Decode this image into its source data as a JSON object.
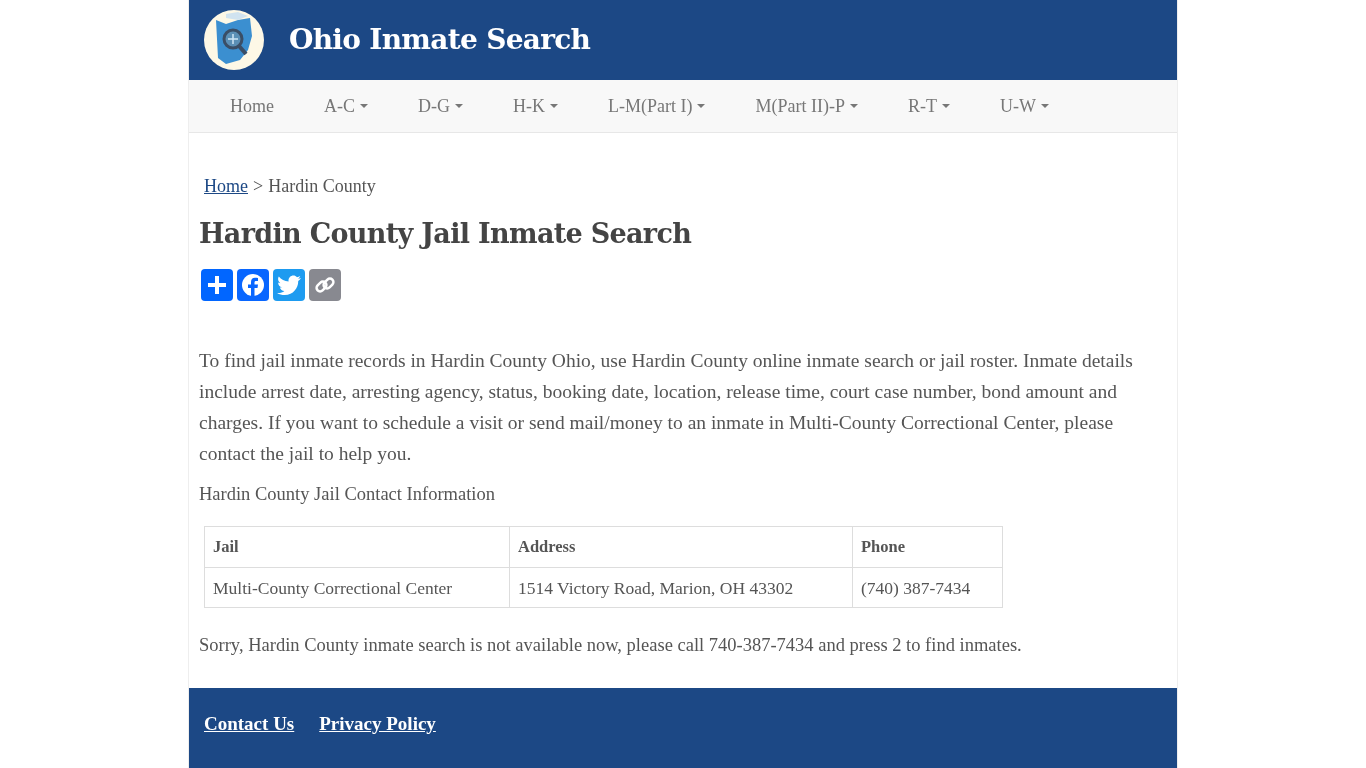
{
  "site": {
    "title": "Ohio Inmate Search"
  },
  "nav": [
    {
      "label": "Home",
      "dropdown": false
    },
    {
      "label": "A-C",
      "dropdown": true
    },
    {
      "label": "D-G",
      "dropdown": true
    },
    {
      "label": "H-K",
      "dropdown": true
    },
    {
      "label": "L-M(Part I)",
      "dropdown": true
    },
    {
      "label": "M(Part II)-P",
      "dropdown": true
    },
    {
      "label": "R-T",
      "dropdown": true
    },
    {
      "label": "U-W",
      "dropdown": true
    }
  ],
  "breadcrumb": {
    "link": "Home",
    "separator": ">",
    "current": "Hardin County"
  },
  "heading": "Hardin County Jail Inmate Search",
  "share_buttons": [
    {
      "kind": "share",
      "color": "#0166ff"
    },
    {
      "kind": "facebook",
      "color": "#0866ff"
    },
    {
      "kind": "twitter",
      "color": "#1d9bf0"
    },
    {
      "kind": "copy",
      "color": "#888990"
    }
  ],
  "intro": "To find jail inmate records in Hardin County Ohio, use Hardin County online inmate search or jail roster. Inmate details include arrest date, arresting agency, status, booking date, location, release time, court case number, bond amount and charges. If you want to schedule a visit or send mail/money to an inmate in Multi-County Correctional Center, please contact the jail to help you.",
  "contact_heading": "Hardin County Jail Contact Information",
  "table": {
    "columns": [
      "Jail",
      "Address",
      "Phone"
    ],
    "rows": [
      [
        "Multi-County Correctional Center",
        "1514 Victory Road, Marion, OH 43302",
        "(740) 387-7434"
      ]
    ]
  },
  "notice": "Sorry, Hardin County inmate search is not available now, please call 740-387-7434 and press 2 to find inmates.",
  "footer": {
    "links": [
      "Contact Us",
      "Privacy Policy"
    ]
  }
}
